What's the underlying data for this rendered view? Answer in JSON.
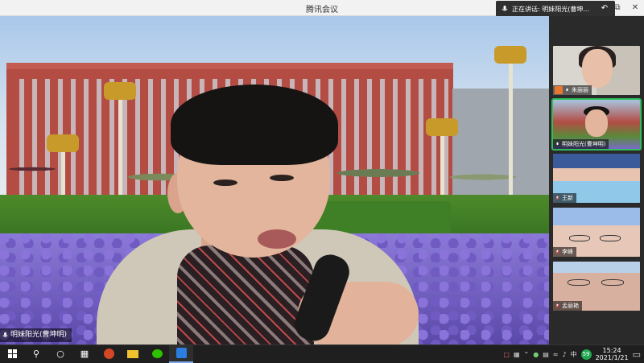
{
  "window": {
    "title": "腾讯会议"
  },
  "speaking_banner": {
    "text": "正在讲话: 明妹阳光(曹坤..."
  },
  "main_video": {
    "speaker_label": "明妹阳光(曹坤明)"
  },
  "participants": [
    {
      "label": "朱丽丽",
      "active": false
    },
    {
      "label": "明妹阳光(曹坤明)",
      "active": true
    },
    {
      "label": "王新",
      "active": false
    },
    {
      "label": "李峰",
      "active": false
    },
    {
      "label": "孟丽艳",
      "active": false
    }
  ],
  "taskbar": {
    "badge": "59",
    "time": "15:24",
    "date": "2021/1/21"
  },
  "colors": {
    "active_border": "#2fbf5a",
    "accent": "#1fa84f"
  }
}
